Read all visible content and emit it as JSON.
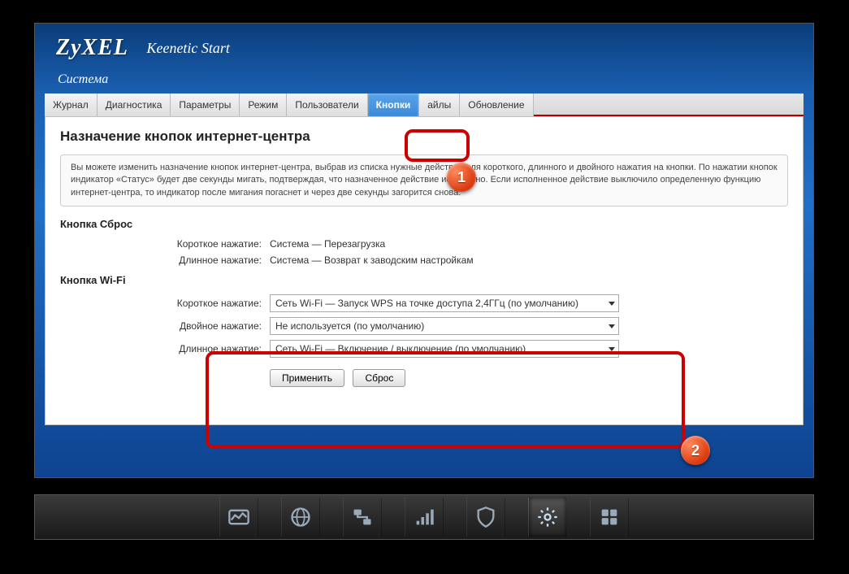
{
  "header": {
    "logo": "ZyXEL",
    "model": "Keenetic Start",
    "section": "Система"
  },
  "tabs": {
    "items": [
      "Журнал",
      "Диагностика",
      "Параметры",
      "Режим",
      "Пользователи",
      "Кнопки",
      "айлы",
      "Обновление"
    ],
    "active_index": 5
  },
  "page": {
    "title": "Назначение кнопок интернет-центра",
    "info": "Вы можете изменить назначение кнопок интернет-центра, выбрав из списка нужные действия для короткого, длинного и двойного нажатия на кнопки. По нажатии кнопок индикатор «Статус» будет две секунды мигать, подтверждая, что назначенное действие исполнено. Если исполненное действие выключило определенную функцию интернет-центра, то индикатор после мигания погаснет и через две секунды загорится снова."
  },
  "reset_section": {
    "heading": "Кнопка Сброс",
    "rows": [
      {
        "label": "Короткое нажатие:",
        "value": "Система — Перезагрузка"
      },
      {
        "label": "Длинное нажатие:",
        "value": "Система — Возврат к заводским настройкам"
      }
    ]
  },
  "wifi_section": {
    "heading": "Кнопка Wi-Fi",
    "rows": [
      {
        "label": "Короткое нажатие:",
        "value": "Сеть Wi-Fi — Запуск WPS на точке доступа 2,4ГГц (по умолчанию)"
      },
      {
        "label": "Двойное нажатие:",
        "value": "Не используется (по умолчанию)"
      },
      {
        "label": "Длинное нажатие:",
        "value": "Сеть Wi-Fi — Включение / выключение (по умолчанию)"
      }
    ]
  },
  "buttons": {
    "apply": "Применить",
    "reset": "Сброс"
  },
  "markers": {
    "one": "1",
    "two": "2"
  }
}
